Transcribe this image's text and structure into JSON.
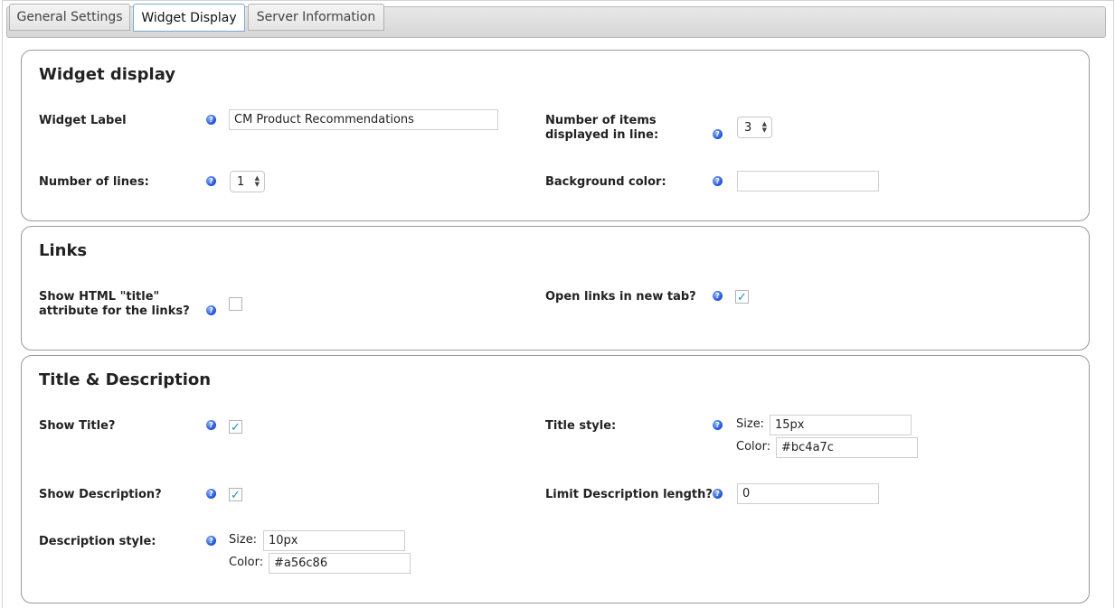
{
  "tabs": [
    {
      "label": "General Settings"
    },
    {
      "label": "Widget Display"
    },
    {
      "label": "Server Information"
    }
  ],
  "help_glyph": "?",
  "check_glyph": "✓",
  "select_arrows": "▲▼",
  "widget_display": {
    "title": "Widget display",
    "widget_label": {
      "label": "Widget Label",
      "value": "CM Product Recommendations"
    },
    "items_in_line": {
      "label_line1": "Number of items",
      "label_line2": "displayed in line:",
      "value": "3"
    },
    "lines": {
      "label": "Number of lines:",
      "value": "1"
    },
    "background_color": {
      "label": "Background color:",
      "value": ""
    }
  },
  "links": {
    "title": "Links",
    "show_title_attr": {
      "label_line1": "Show HTML \"title\"",
      "label_line2": "attribute for the links?",
      "checked": false
    },
    "open_new_tab": {
      "label": "Open links in new tab?",
      "checked": true
    }
  },
  "title_description": {
    "title": "Title & Description",
    "show_title": {
      "label": "Show Title?",
      "checked": true
    },
    "title_style": {
      "label": "Title style:",
      "size_label": "Size:",
      "size_value": "15px",
      "color_label": "Color:",
      "color_value": "#bc4a7c"
    },
    "show_description": {
      "label": "Show Description?",
      "checked": true
    },
    "limit_description": {
      "label": "Limit Description length?",
      "value": "0"
    },
    "description_style": {
      "label": "Description style:",
      "size_label": "Size:",
      "size_value": "10px",
      "color_label": "Color:",
      "color_value": "#a56c86"
    }
  },
  "colors": {
    "accent": "#1e8cbe",
    "help_icon": "#1b4fcf",
    "panel_border": "#999999"
  }
}
